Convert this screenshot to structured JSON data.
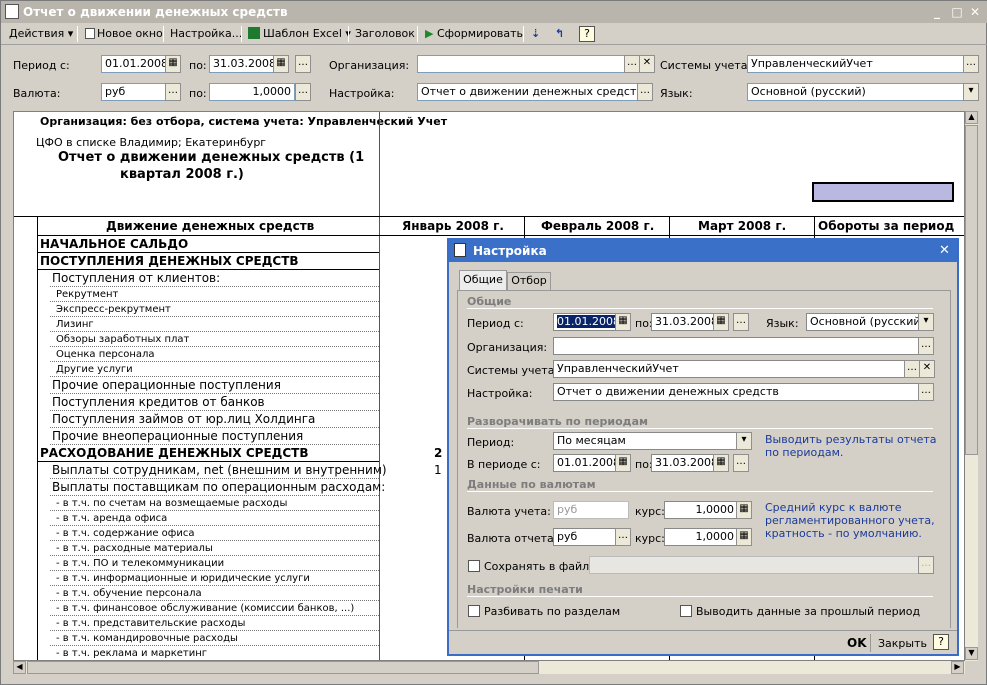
{
  "window": {
    "title": "Отчет о движении денежных средств"
  },
  "toolbar": {
    "actions": "Действия",
    "new_window": "Новое окно",
    "settings": "Настройка...",
    "excel_template": "Шаблон Excel",
    "header": "Заголовок",
    "generate": "Сформировать",
    "help": "?"
  },
  "filters": {
    "period_from_label": "Период с:",
    "period_from": "01.01.2008",
    "period_to_label": "по:",
    "period_to": "31.03.2008",
    "org_label": "Организация:",
    "org_value": "",
    "systems_label": "Системы учета:",
    "systems_value": "УправленческийУчет",
    "currency_label": "Валюта:",
    "currency_value": "руб",
    "rate_label": "по:",
    "rate_value": "1,0000",
    "settings_label": "Настройка:",
    "settings_value": "Отчет о движении денежных средств",
    "lang_label": "Язык:",
    "lang_value": "Основной (русский)"
  },
  "report": {
    "org_line": "Организация: без отбора, система учета: Управленческий Учет",
    "cfo_line": "ЦФО в списке Владимир; Екатеринбург",
    "title_line1": "Отчет о движении денежных средств  (1",
    "title_line2": "квартал 2008 г.)",
    "columns": [
      "Движение денежных средств",
      "Январь 2008 г.",
      "Февраль 2008 г.",
      "Март 2008 г.",
      "Обороты за период"
    ],
    "rows": [
      {
        "text": "НАЧАЛЬНОЕ САЛЬДО",
        "style": "bold"
      },
      {
        "text": "ПОСТУПЛЕНИЯ ДЕНЕЖНЫХ СРЕДСТВ",
        "style": "bold"
      },
      {
        "text": "Поступления от клиентов:",
        "style": "l1"
      },
      {
        "text": "Рекрутмент",
        "style": "l2"
      },
      {
        "text": "Экспресс-рекрутмент",
        "style": "l2"
      },
      {
        "text": "Лизинг",
        "style": "l2"
      },
      {
        "text": "Обзоры заработных плат",
        "style": "l2"
      },
      {
        "text": "Оценка персонала",
        "style": "l2"
      },
      {
        "text": "Другие услуги",
        "style": "l2"
      },
      {
        "text": "Прочие операционные поступления",
        "style": "l1"
      },
      {
        "text": "Поступления кредитов от банков",
        "style": "l1"
      },
      {
        "text": "Поступления займов от юр.лиц Холдинга",
        "style": "l1"
      },
      {
        "text": "Прочие внеоперационные поступления",
        "style": "l1"
      },
      {
        "text": "РАСХОДОВАНИЕ ДЕНЕЖНЫХ СРЕДСТВ",
        "style": "bold",
        "val": "2"
      },
      {
        "text": "Выплаты сотрудникам, net (внешним и внутренним)",
        "style": "l1",
        "val": "1"
      },
      {
        "text": "Выплаты поставщикам по операционным расходам:",
        "style": "l1"
      },
      {
        "text": "- в т.ч. по счетам на возмещаемые расходы",
        "style": "l2"
      },
      {
        "text": "- в т.ч. аренда офиса",
        "style": "l2"
      },
      {
        "text": "- в т.ч. содержание офиса",
        "style": "l2"
      },
      {
        "text": "- в т.ч. расходные материалы",
        "style": "l2"
      },
      {
        "text": "- в т.ч. ПО и телекоммуникации",
        "style": "l2"
      },
      {
        "text": "- в т.ч. информационные и юридические услуги",
        "style": "l2"
      },
      {
        "text": "- в т.ч. обучение персонала",
        "style": "l2"
      },
      {
        "text": "- в т.ч. финансовое обслуживание (комиссии банков, ...)",
        "style": "l2"
      },
      {
        "text": "- в т.ч. представительские расходы",
        "style": "l2"
      },
      {
        "text": "- в т.ч. командировочные расходы",
        "style": "l2"
      },
      {
        "text": "- в т.ч. реклама и маркетинг",
        "style": "l2"
      }
    ]
  },
  "dialog": {
    "title": "Настройка",
    "tab_general": "Общие",
    "tab_filter": "Отбор",
    "sec_general": "Общие",
    "period_from_label": "Период с:",
    "period_from": "01.01.2008",
    "period_to_label": "по:",
    "period_to": "31.03.2008",
    "lang_label": "Язык:",
    "lang_value": "Основной (русский)",
    "org_label": "Организация:",
    "org_value": "",
    "systems_label": "Системы учета:",
    "systems_value": "УправленческийУчет",
    "settings_label": "Настройка:",
    "settings_value": "Отчет о движении денежных средств",
    "sec_expand": "Разворачивать по периодам",
    "period_label": "Период:",
    "period_value": "По месяцам",
    "in_period_label": "В периоде с:",
    "in_period_from": "01.01.2008",
    "in_period_to_label": "по:",
    "in_period_to": "31.03.2008",
    "period_hint": "Выводить результаты отчета по периодам.",
    "sec_currency": "Данные по валютам",
    "acc_currency_label": "Валюта учета:",
    "acc_currency": "руб",
    "rate_label": "курс:",
    "acc_rate": "1,0000",
    "rep_currency_label": "Валюта отчета:",
    "rep_currency": "руб",
    "rep_rate": "1,0000",
    "currency_hint": "Средний курс к валюте регламентированного учета, кратность - по умолчанию.",
    "save_to_file": "Сохранять в файл",
    "sec_print": "Настройки печати",
    "split_sections": "Разбивать по разделам",
    "prev_period": "Выводить данные за прошлый период",
    "ok": "OK",
    "close": "Закрыть",
    "help": "?"
  }
}
